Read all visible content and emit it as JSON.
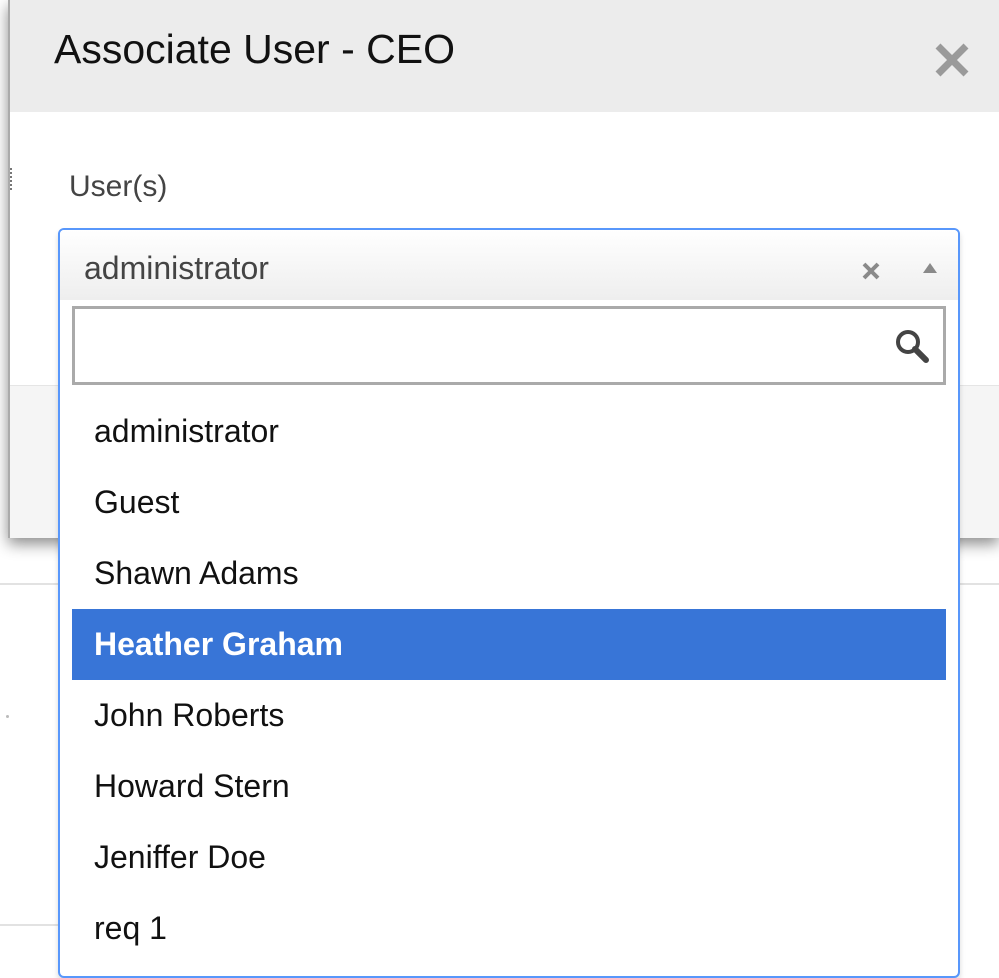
{
  "dialog": {
    "title": "Associate User - CEO",
    "close_icon": "close-icon"
  },
  "form": {
    "users_label": "User(s)"
  },
  "select": {
    "selected_value": "administrator",
    "clear_icon": "clear-icon",
    "arrow_icon": "chevron-up-icon",
    "search": {
      "value": "",
      "placeholder": "",
      "icon": "search-icon"
    },
    "highlighted_index": 3,
    "options": [
      {
        "label": "administrator"
      },
      {
        "label": "Guest"
      },
      {
        "label": "Shawn Adams"
      },
      {
        "label": "Heather Graham"
      },
      {
        "label": "John Roberts"
      },
      {
        "label": "Howard Stern"
      },
      {
        "label": "Jeniffer Doe"
      },
      {
        "label": "req 1"
      }
    ]
  },
  "colors": {
    "highlight": "#3875d7",
    "focus_border": "#5897fb",
    "header_bg": "#ececec"
  }
}
